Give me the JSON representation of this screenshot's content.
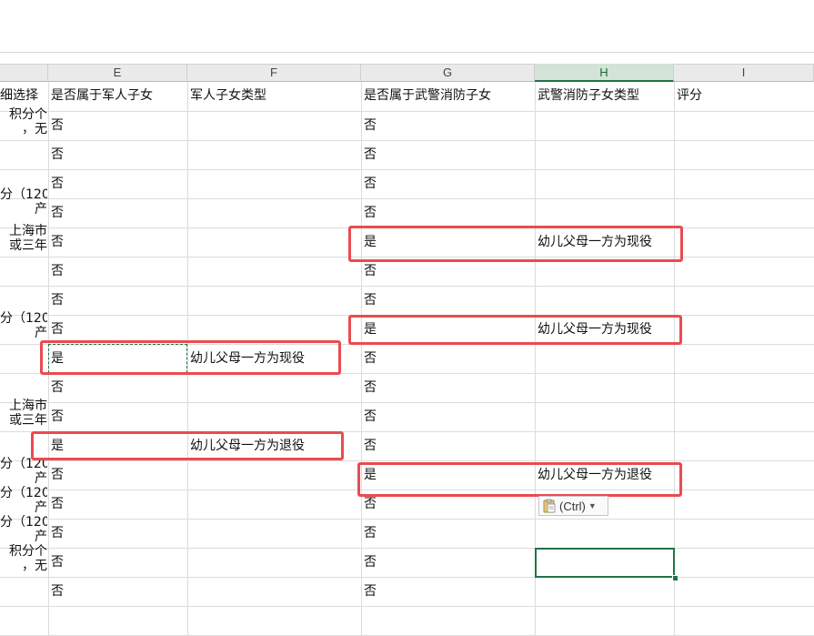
{
  "columns": [
    {
      "letter": "E",
      "header": "是否属于军人子女"
    },
    {
      "letter": "F",
      "header": "军人子女类型"
    },
    {
      "letter": "G",
      "header": "是否属于武警消防子女"
    },
    {
      "letter": "H",
      "header": "武警消防子女类型"
    },
    {
      "letter": "I",
      "header": "评分"
    }
  ],
  "partial_column": {
    "header": "细选择",
    "fragments": [
      {
        "lines": [
          "积分个",
          "，无"
        ]
      },
      {
        "lines": [
          "分（120",
          "产"
        ]
      },
      {
        "lines": [
          "上海市",
          "或三年"
        ]
      },
      {
        "lines": [
          "分（120",
          "产"
        ]
      },
      {
        "lines": [
          "上海市",
          "或三年"
        ]
      },
      {
        "lines": [
          "分（120",
          "产"
        ]
      },
      {
        "lines": [
          "分（120",
          "产"
        ]
      },
      {
        "lines": [
          "分（120",
          "产"
        ]
      },
      {
        "lines": [
          "积分个",
          "，无"
        ]
      }
    ]
  },
  "rows": [
    {
      "e": "否",
      "f": "",
      "g": "否",
      "h": ""
    },
    {
      "e": "否",
      "f": "",
      "g": "否",
      "h": ""
    },
    {
      "e": "否",
      "f": "",
      "g": "否",
      "h": ""
    },
    {
      "e": "否",
      "f": "",
      "g": "否",
      "h": ""
    },
    {
      "e": "否",
      "f": "",
      "g": "是",
      "h": "幼儿父母一方为现役"
    },
    {
      "e": "否",
      "f": "",
      "g": "否",
      "h": ""
    },
    {
      "e": "否",
      "f": "",
      "g": "否",
      "h": ""
    },
    {
      "e": "否",
      "f": "",
      "g": "是",
      "h": "幼儿父母一方为现役"
    },
    {
      "e": "是",
      "f": "幼儿父母一方为现役",
      "g": "否",
      "h": ""
    },
    {
      "e": "否",
      "f": "",
      "g": "否",
      "h": ""
    },
    {
      "e": "否",
      "f": "",
      "g": "否",
      "h": ""
    },
    {
      "e": "是",
      "f": "幼儿父母一方为退役",
      "g": "否",
      "h": ""
    },
    {
      "e": "否",
      "f": "",
      "g": "是",
      "h": "幼儿父母一方为退役"
    },
    {
      "e": "否",
      "f": "",
      "g": "否",
      "h": ""
    },
    {
      "e": "否",
      "f": "",
      "g": "否",
      "h": ""
    },
    {
      "e": "否",
      "f": "",
      "g": "否",
      "h": ""
    },
    {
      "e": "否",
      "f": "",
      "g": "否",
      "h": ""
    }
  ],
  "paste_options": {
    "label": "(Ctrl)",
    "icon": "clipboard-icon",
    "caret_icon": "caret-down-icon"
  },
  "colors": {
    "highlight": "#ea4b50",
    "excel_green": "#217346",
    "selected_header": "#d3e3d7"
  },
  "selected_column": "H"
}
